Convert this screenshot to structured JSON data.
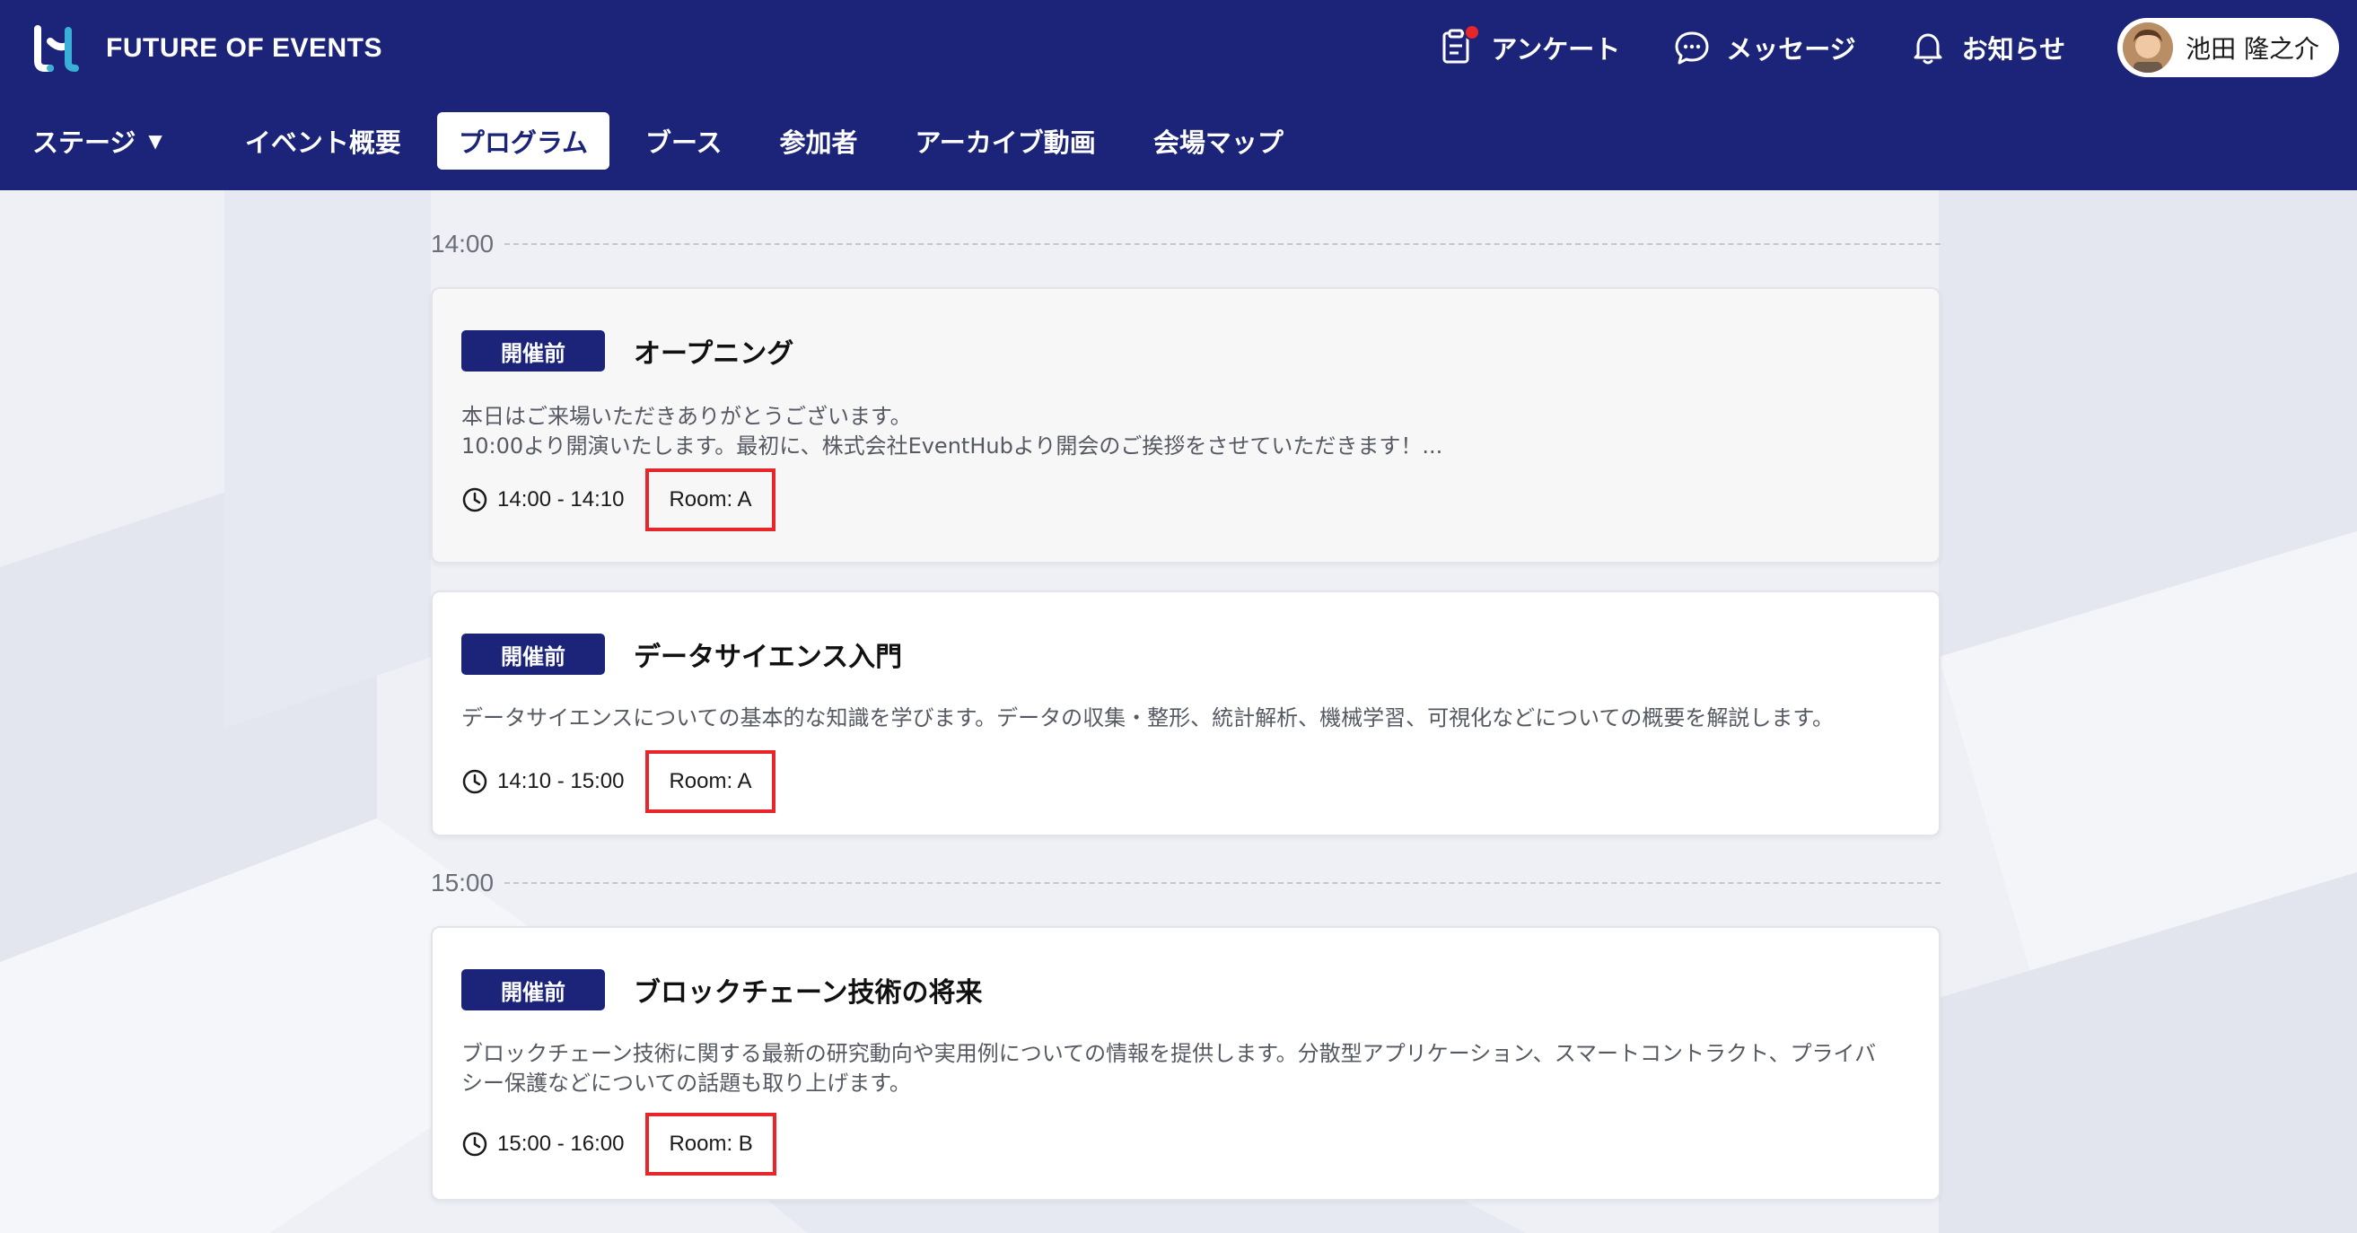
{
  "brand": {
    "name": "FUTURE OF EVENTS",
    "accent": "#1c247a",
    "logo_teal": "#3ab0d8"
  },
  "top_actions": {
    "survey": {
      "label": "アンケート",
      "icon": "survey-icon",
      "has_notification": true
    },
    "messages": {
      "label": "メッセージ",
      "icon": "chat-bubble-icon"
    },
    "notifications": {
      "label": "お知らせ",
      "icon": "bell-icon"
    },
    "user": {
      "name": "池田 隆之介"
    }
  },
  "nav": {
    "items": [
      {
        "label": "ステージ",
        "has_dropdown": true
      },
      {
        "label": "イベント概要"
      },
      {
        "label": "プログラム",
        "active": true
      },
      {
        "label": "ブース"
      },
      {
        "label": "参加者"
      },
      {
        "label": "アーカイブ動画"
      },
      {
        "label": "会場マップ"
      }
    ]
  },
  "schedule": {
    "slots": [
      {
        "time": "14:00",
        "sessions": [
          {
            "status": "開催前",
            "title": "オープニング",
            "desc_lines": [
              "本日はご来場いただきありがとうございます。",
              "10:00より開演いたします。最初に、株式会社EventHubより開会のご挨拶をさせていただきます！..."
            ],
            "time": "14:00 - 14:10",
            "room": "Room: A"
          },
          {
            "status": "開催前",
            "title": "データサイエンス入門",
            "desc_lines": [
              "データサイエンスについての基本的な知識を学びます。データの収集・整形、統計解析、機械学習、可視化などについての概要を解説します。"
            ],
            "time": "14:10 - 15:00",
            "room": "Room: A"
          }
        ]
      },
      {
        "time": "15:00",
        "sessions": [
          {
            "status": "開催前",
            "title": "ブロックチェーン技術の将来",
            "desc_lines": [
              "ブロックチェーン技術に関する最新の研究動向や実用例についての情報を提供します。分散型アプリケーション、スマートコントラクト、プライバ",
              "シー保護などについての話題も取り上げます。"
            ],
            "time": "15:00 - 16:00",
            "room": "Room: B"
          }
        ]
      }
    ]
  }
}
